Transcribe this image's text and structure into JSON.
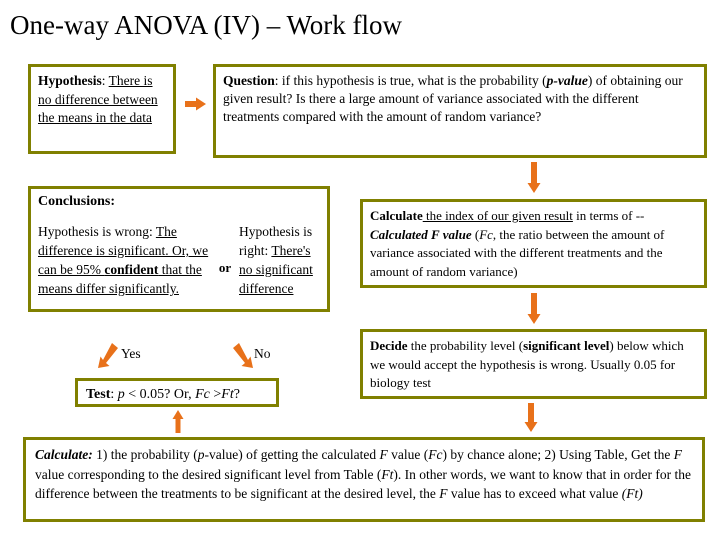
{
  "slide": {
    "title": "One-way ANOVA (IV) – Work flow",
    "accent_color": "#808000",
    "arrow_color": "#E8711A",
    "background": "#FFFFFF"
  },
  "hypothesis_box": {
    "label_bold": "Hypothesis",
    "separator": ": ",
    "underlined_text": "There is no difference between the means in the data"
  },
  "question_box": {
    "label_bold": "Question",
    "separator": ": if this hypothesis is true, what is the probability (",
    "emphasis": "p-value",
    "rest": ") of obtaining our given result? Is there a large amount of variance associated with the different treatments compared with the amount of random variance?"
  },
  "conclusions_box": {
    "heading": "Conclusions:",
    "left_prefix": "Hypothesis is wrong: ",
    "left_underlined_1": "The difference is significant. Or, we can be 95% ",
    "left_bold_underlined": "confident",
    "left_underlined_2": " that the means differ significantly.",
    "or_label": "or",
    "right_prefix": "Hypothesis is right: ",
    "right_underlined": "There's no significant difference"
  },
  "calculate_index_box": {
    "label_bold": "Calculate",
    "underlined": " the index of our given result",
    "mid": " in terms of -- ",
    "emphasis": "Calculated F value",
    "paren_open": " (",
    "fc": "Fc",
    "rest": ", the ratio between the amount of variance associated with the different treatments and the amount of random variance)"
  },
  "decide_box": {
    "label_bold": "Decide",
    "mid": " the probability level (",
    "emphasis_bold": "significant level",
    "rest": ") below which we would accept the hypothesis is wrong. Usually 0.05 for biology test"
  },
  "test_box": {
    "label_bold": "Test",
    "sep": ": ",
    "p": "p",
    "cond1": " < 0.05? Or, ",
    "fc": "Fc",
    "gt": " >",
    "ft": "Ft",
    "q": "?"
  },
  "branches": {
    "yes_label": "Yes",
    "no_label": "No"
  },
  "calculate_final_box": {
    "label_bold_italic": "Calculate:",
    "part1": " 1) the probability (",
    "p": "p",
    "part2": "-value) of getting the calculated ",
    "f1": "F",
    "part3": " value (",
    "fc": "Fc",
    "part4": ") by chance alone; 2) Using Table, Get the ",
    "f2": "F",
    "part5": " value corresponding to the desired significant level from Table (",
    "ft1": "Ft",
    "part6": ").  In other words, we want to know that in order for the difference between the treatments to be significant at the desired level, the ",
    "f3": "F",
    "part7": " value has to exceed what value ",
    "ft2": "(Ft)"
  },
  "arrows": [
    {
      "name": "arrow-hypothesis-to-question",
      "direction": "right"
    },
    {
      "name": "arrow-question-to-calculate",
      "direction": "down"
    },
    {
      "name": "arrow-calculate-to-decide",
      "direction": "down"
    },
    {
      "name": "arrow-decide-to-final",
      "direction": "down"
    },
    {
      "name": "arrow-final-to-test",
      "direction": "up"
    },
    {
      "name": "arrow-yes-branch",
      "direction": "down-left"
    },
    {
      "name": "arrow-no-branch",
      "direction": "up-right"
    }
  ]
}
